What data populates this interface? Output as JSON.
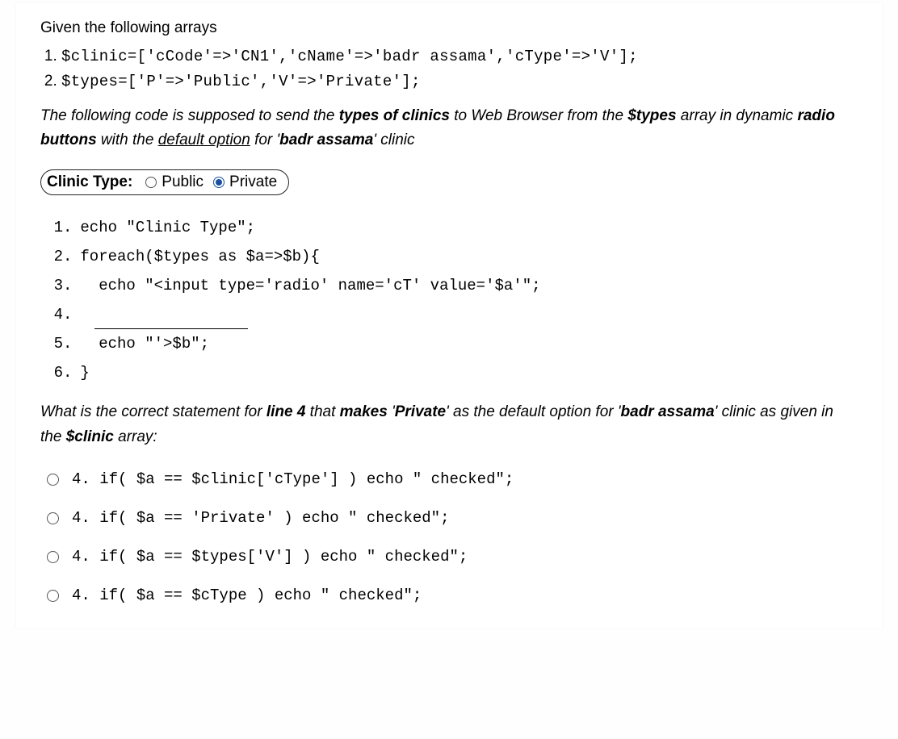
{
  "intro": "Given the following arrays",
  "arrays": [
    "$clinic=['cCode'=>'CN1','cName'=>'badr assama','cType'=>'V'];",
    "$types=['P'=>'Public','V'=>'Private'];"
  ],
  "desc_pre": "The following code is supposed to send the ",
  "desc_types": "types of clinics",
  "desc_mid1": " to Web Browser from the ",
  "desc_var": "$types",
  "desc_mid2": " array in dynamic  ",
  "desc_radio": "radio buttons",
  "desc_mid3": " with the ",
  "desc_default": "default option",
  "desc_mid4": " for '",
  "desc_clinic": "badr assama",
  "desc_end": "' clinic",
  "chip": {
    "label": "Clinic Type:",
    "opt1": "Public",
    "opt2": "Private",
    "selected": 2
  },
  "code_lines": [
    {
      "n": "1",
      "txt": "echo \"Clinic Type\";"
    },
    {
      "n": "2",
      "txt": "foreach($types as $a=>$b){"
    },
    {
      "n": "3",
      "txt": "  echo \"<input type='radio' name='cT' value='$a'\";"
    },
    {
      "n": "4",
      "txt": "",
      "blank": true
    },
    {
      "n": "5",
      "txt": "  echo \"'>$b\";"
    },
    {
      "n": "6",
      "txt": "}"
    }
  ],
  "question_pre": "What is the correct statement for ",
  "question_line": "line 4",
  "question_mid1": " that ",
  "question_makes": "makes",
  "question_mid2": " '",
  "question_priv": "Private",
  "question_mid3": "' as the default option for '",
  "question_clinic": "badr assama",
  "question_mid4": "' clinic as given in the ",
  "question_var": "$clinic",
  "question_end": " array:",
  "answers": [
    "4. if( $a == $clinic['cType'] ) echo \" checked\";",
    "4. if( $a == 'Private' ) echo \" checked\";",
    "4. if( $a == $types['V'] ) echo \" checked\";",
    "4. if( $a == $cType ) echo \" checked\";"
  ]
}
